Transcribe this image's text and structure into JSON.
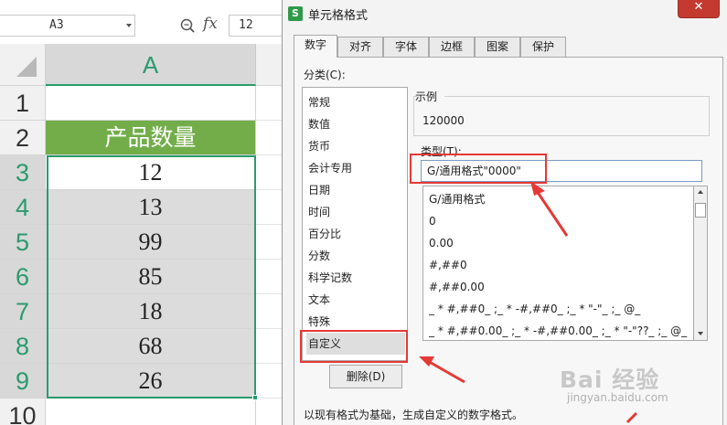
{
  "spreadsheet": {
    "name_box": "A3",
    "formula_value": "12",
    "column_header": "A",
    "row_numbers": [
      "1",
      "2",
      "3",
      "4",
      "5",
      "6",
      "7",
      "8",
      "9",
      "10"
    ],
    "cells": [
      "",
      "产品数量",
      "12",
      "13",
      "99",
      "85",
      "18",
      "68",
      "26",
      ""
    ]
  },
  "dialog": {
    "title": "单元格格式",
    "close_symbol": "✕",
    "tabs": [
      "数字",
      "对齐",
      "字体",
      "边框",
      "图案",
      "保护"
    ],
    "category_label": "分类(C):",
    "categories": [
      "常规",
      "数值",
      "货币",
      "会计专用",
      "日期",
      "时间",
      "百分比",
      "分数",
      "科学记数",
      "文本",
      "特殊",
      "自定义"
    ],
    "selected_category": "自定义",
    "sample_label": "示例",
    "sample_value": "120000",
    "type_label": "类型(T):",
    "type_value": "G/通用格式\"0000\"",
    "format_list": [
      "G/通用格式",
      "0",
      "0.00",
      "#,##0",
      "#,##0.00",
      "_ * #,##0_ ;_ * -#,##0_ ;_ * \"-\"_ ;_ @_",
      "_ * #,##0.00_ ;_ * -#,##0.00_ ;_ * \"-\"??_ ;_ @_"
    ],
    "delete_button": "删除(D)",
    "description": "以现有格式为基础，生成自定义的数字格式。"
  },
  "watermark": {
    "main": "Bai 经验",
    "sub": "jingyan.baidu.com"
  },
  "colors": {
    "accent_green": "#2a9b6d",
    "header_fill": "#72ad4a",
    "highlight_red": "#e53935",
    "close_red": "#c43a30"
  }
}
